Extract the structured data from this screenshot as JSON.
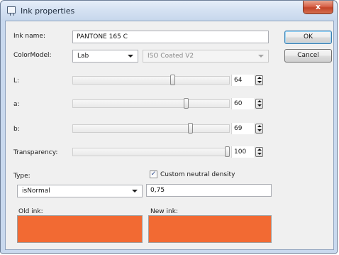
{
  "window": {
    "title": "Ink properties",
    "close_glyph": "x"
  },
  "ink_name": {
    "label": "Ink name:",
    "value": "PANTONE 165 C"
  },
  "color_model": {
    "label": "ColorModel:",
    "selected": "Lab",
    "profile": "ISO Coated V2"
  },
  "sliders": [
    {
      "label": "L:",
      "value": "64",
      "position": 0.64
    },
    {
      "label": "a:",
      "value": "60",
      "position": 0.73
    },
    {
      "label": "b:",
      "value": "69",
      "position": 0.76
    },
    {
      "label": "Transparency:",
      "value": "100",
      "position": 1.0
    }
  ],
  "type": {
    "label": "Type:",
    "selected": "isNormal"
  },
  "custom_neutral_density": {
    "label": "Custom neutral density",
    "checked": true,
    "check_glyph": "✓",
    "value": "0,75"
  },
  "old_ink": {
    "label": "Old ink:",
    "color": "#f26a33"
  },
  "new_ink": {
    "label": "New ink:",
    "color": "#f26a33"
  },
  "buttons": {
    "ok": "OK",
    "cancel": "Cancel"
  }
}
